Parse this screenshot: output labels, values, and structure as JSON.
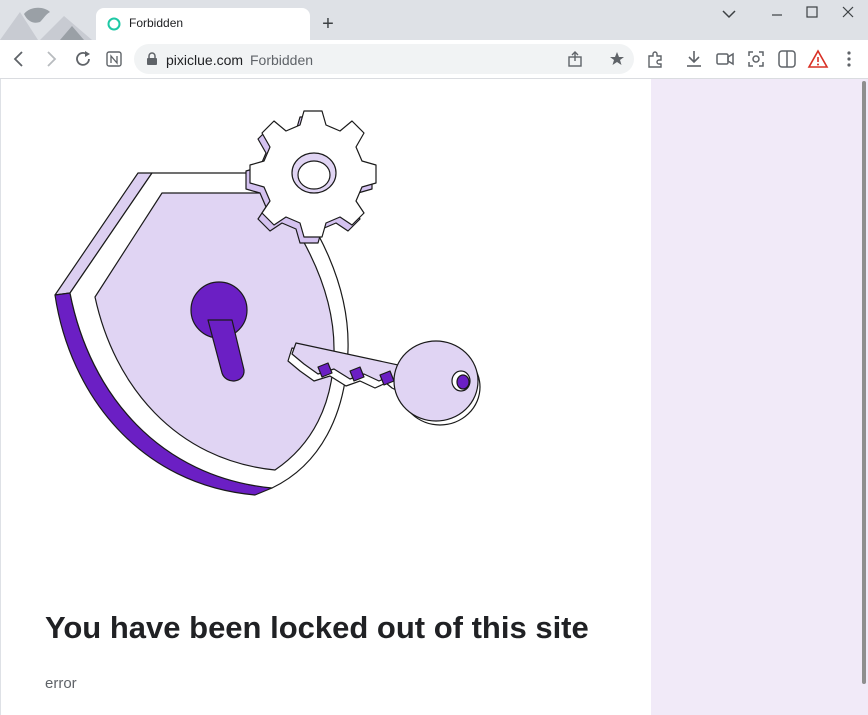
{
  "browser": {
    "tab": {
      "title": "Forbidden",
      "favicon": "circle-outline-icon",
      "favicon_color": "#1ec8a5"
    },
    "new_tab": "+",
    "address": {
      "host": "pixiclue.com",
      "path": "Forbidden"
    },
    "window_controls": [
      "chevron-down-icon",
      "minimize-icon",
      "maximize-icon",
      "close-icon"
    ],
    "toolbar_icons": [
      "back-icon",
      "forward-icon",
      "reload-icon",
      "notion-icon",
      "share-icon",
      "star-icon",
      "extensions-icon",
      "download-icon",
      "video-icon",
      "screenshot-icon",
      "sidepanel-icon",
      "warning-icon",
      "menu-icon"
    ]
  },
  "page": {
    "heading": "You have been locked out of this site",
    "subtext": "error",
    "illustration": "shield-lock-key-illustration"
  },
  "colors": {
    "purple_dark": "#6b1fc4",
    "purple_light": "#e0d4f3",
    "panel_bg": "#f1eaf8",
    "warning": "#d93025"
  }
}
